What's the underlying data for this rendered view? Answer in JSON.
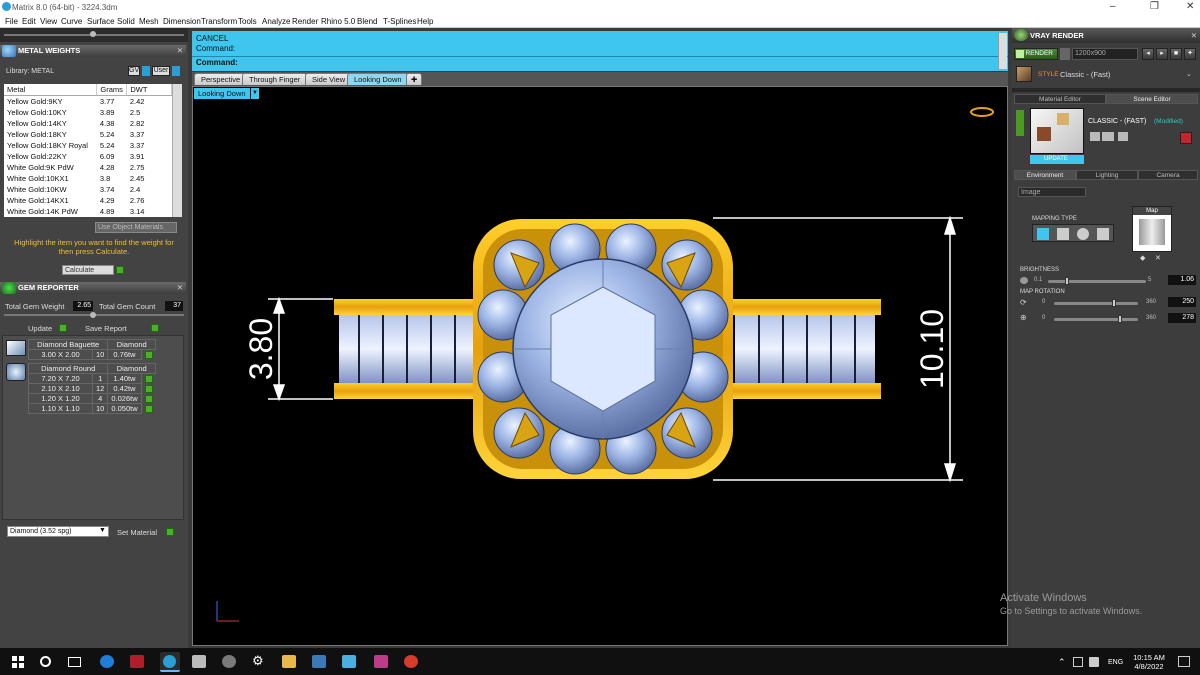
{
  "window": {
    "title": "Matrix 8.0 (64-bit) - 3224.3dm",
    "min": "–",
    "max": "❐",
    "close": "✕"
  },
  "menu": [
    "File",
    "Edit",
    "View",
    "Curve",
    "Surface",
    "Solid",
    "Mesh",
    "Dimension",
    "Transform",
    "Tools",
    "Analyze",
    "Render",
    "Rhino 5.0",
    "Blend",
    "T-Splines",
    "Help"
  ],
  "metal_weights": {
    "header": "METAL WEIGHTS",
    "library_label": "Library: METAL",
    "lib_btn1": "GV",
    "lib_btn2": "User",
    "columns": [
      "Metal",
      "Grams",
      "DWT"
    ],
    "rows": [
      [
        "Yellow Gold:9KY",
        "3.77",
        "2.42"
      ],
      [
        "Yellow Gold:10KY",
        "3.89",
        "2.5"
      ],
      [
        "Yellow Gold:14KY",
        "4.38",
        "2.82"
      ],
      [
        "Yellow Gold:18KY",
        "5.24",
        "3.37"
      ],
      [
        "Yellow Gold:18KY Royal",
        "5.24",
        "3.37"
      ],
      [
        "Yellow Gold:22KY",
        "6.09",
        "3.91"
      ],
      [
        "White Gold:9K PdW",
        "4.28",
        "2.75"
      ],
      [
        "White Gold:10KX1",
        "3.8",
        "2.45"
      ],
      [
        "White Gold:10KW",
        "3.74",
        "2.4"
      ],
      [
        "White Gold:14KX1",
        "4.29",
        "2.76"
      ],
      [
        "White Gold:14K PdW",
        "4.89",
        "3.14"
      ]
    ],
    "use_object_materials": "Use Object Materials",
    "hint": "Highlight the item you want to find the weight for then press Calculate.",
    "calculate": "Calculate"
  },
  "gem_reporter": {
    "header": "GEM REPORTER",
    "total_weight_label": "Total Gem Weight",
    "total_weight": "2.65",
    "total_count_label": "Total Gem Count",
    "total_count": "37",
    "update": "Update",
    "save_report": "Save Report",
    "groups": [
      {
        "name": "Diamond Baguette",
        "material": "Diamond",
        "rows": [
          [
            "3.00 X 2.00",
            "10",
            "0.76tw"
          ]
        ]
      },
      {
        "name": "Diamond Round",
        "material": "Diamond",
        "rows": [
          [
            "7.20 X 7.20",
            "1",
            "1.40tw"
          ],
          [
            "2.10 X 2.10",
            "12",
            "0.42tw"
          ],
          [
            "1.20 X 1.20",
            "4",
            "0.026tw"
          ],
          [
            "1.10 X 1.10",
            "10",
            "0.050tw"
          ]
        ]
      }
    ],
    "material_select": "Diamond      (3.52 spg)",
    "set_material": "Set Material"
  },
  "command": {
    "line1": "CANCEL",
    "line2": "Command:",
    "line3": "Command:"
  },
  "view_tabs": [
    "Perspective",
    "Through Finger",
    "Side View",
    "Looking Down"
  ],
  "view_tab_add": "✚",
  "view_label": "Looking Down",
  "dimensions": {
    "left": "3.80",
    "right": "10.10"
  },
  "vray": {
    "header": "VRAY RENDER",
    "render_btn": "RENDER",
    "resolution": "1200x900",
    "style_label": "STYLE",
    "style_value": "Classic - (Fast)",
    "tabs": [
      "Material Editor",
      "Scene Editor"
    ],
    "preset_name": "CLASSIC - (FAST)",
    "preset_state": "(Modified)",
    "update": "UPDATE",
    "env_tabs": [
      "Environment",
      "Lighting",
      "Camera"
    ],
    "env_select": "Image",
    "mapping_type": "MAPPING TYPE",
    "map_label": "Map",
    "brightness_label": "BRIGHTNESS",
    "brightness_min": "0.1",
    "brightness_max": "5",
    "brightness_val": "1.06",
    "brightness_level": 0.18,
    "map_rotation_label": "MAP ROTATION",
    "rot1_min": "0",
    "rot1_max": "360",
    "rot1_val": "250",
    "rot2_min": "0",
    "rot2_max": "360",
    "rot2_val": "278"
  },
  "watermark": {
    "line1": "Activate Windows",
    "line2": "Go to Settings to activate Windows."
  },
  "taskbar": {
    "time": "10:15 AM",
    "date": "4/8/2022",
    "lang": "ENG"
  }
}
